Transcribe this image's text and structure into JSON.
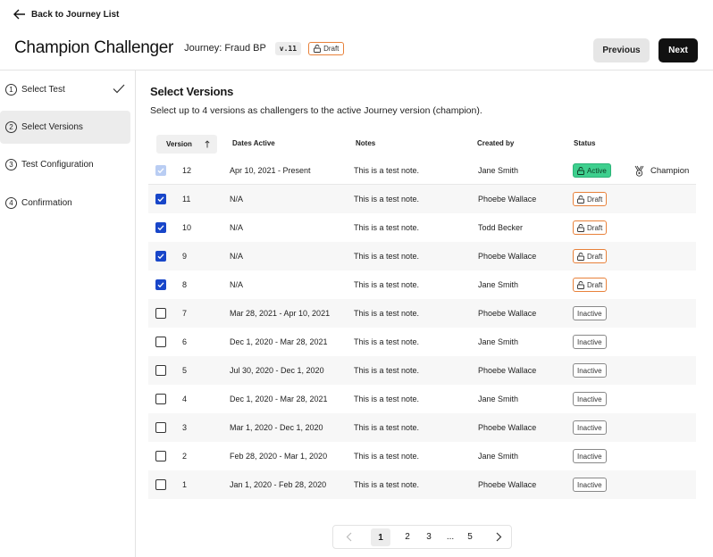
{
  "header": {
    "back_label": "Back to Journey List",
    "title": "Champion Challenger",
    "journey": "Journey: Fraud BP",
    "version": "v.11",
    "status": "Draft",
    "previous_label": "Previous",
    "next_label": "Next"
  },
  "steps": [
    {
      "num": "1",
      "label": "Select Test",
      "done": true
    },
    {
      "num": "2",
      "label": "Select Versions",
      "active": true
    },
    {
      "num": "3",
      "label": "Test Configuration"
    },
    {
      "num": "4",
      "label": "Confirmation"
    }
  ],
  "main": {
    "title": "Select Versions",
    "subtitle": "Select up to 4 versions as challengers to the active Journey version (champion).",
    "columns": {
      "version": "Version",
      "dates": "Dates Active",
      "notes": "Notes",
      "created": "Created by",
      "status": "Status"
    },
    "rows": [
      {
        "checked": "disabled",
        "version": "12",
        "dates": "Apr 10, 2021 - Present",
        "notes": "This is a test note.",
        "created": "Jane Smith",
        "status": "Active",
        "status_type": "active",
        "extra": "Champion"
      },
      {
        "checked": "checked",
        "version": "11",
        "dates": "N/A",
        "notes": "This is a test note.",
        "created": "Phoebe Wallace",
        "status": "Draft",
        "status_type": "draft"
      },
      {
        "checked": "checked",
        "version": "10",
        "dates": "N/A",
        "notes": "This is a test note.",
        "created": "Todd Becker",
        "status": "Draft",
        "status_type": "draft"
      },
      {
        "checked": "checked",
        "version": "9",
        "dates": "N/A",
        "notes": "This is a test note.",
        "created": "Phoebe Wallace",
        "status": "Draft",
        "status_type": "draft"
      },
      {
        "checked": "checked",
        "version": "8",
        "dates": "N/A",
        "notes": "This is a test note.",
        "created": "Jane Smith",
        "status": "Draft",
        "status_type": "draft"
      },
      {
        "checked": "unchecked",
        "version": "7",
        "dates": "Mar 28, 2021 - Apr 10, 2021",
        "notes": "This is a test note.",
        "created": "Phoebe Wallace",
        "status": "Inactive",
        "status_type": "inactive"
      },
      {
        "checked": "unchecked",
        "version": "6",
        "dates": "Dec 1, 2020 - Mar 28, 2021",
        "notes": "This is a test note.",
        "created": "Jane Smith",
        "status": "Inactive",
        "status_type": "inactive"
      },
      {
        "checked": "unchecked",
        "version": "5",
        "dates": "Jul 30, 2020 - Dec 1, 2020",
        "notes": "This is a test note.",
        "created": "Phoebe Wallace",
        "status": "Inactive",
        "status_type": "inactive"
      },
      {
        "checked": "unchecked",
        "version": "4",
        "dates": "Dec 1, 2020 - Mar 28, 2021",
        "notes": "This is a test note.",
        "created": "Jane Smith",
        "status": "Inactive",
        "status_type": "inactive"
      },
      {
        "checked": "unchecked",
        "version": "3",
        "dates": "Mar 1, 2020 - Dec 1, 2020",
        "notes": "This is a test note.",
        "created": "Phoebe Wallace",
        "status": "Inactive",
        "status_type": "inactive"
      },
      {
        "checked": "unchecked",
        "version": "2",
        "dates": "Feb 28, 2020 - Mar 1, 2020",
        "notes": "This is a test note.",
        "created": "Jane Smith",
        "status": "Inactive",
        "status_type": "inactive"
      },
      {
        "checked": "unchecked",
        "version": "1",
        "dates": "Jan 1, 2020 - Feb 28, 2020",
        "notes": "This is a test note.",
        "created": "Phoebe Wallace",
        "status": "Inactive",
        "status_type": "inactive"
      }
    ]
  },
  "pagination": {
    "pages": [
      "1",
      "2",
      "3",
      "...",
      "5"
    ],
    "current": "1"
  },
  "colors": {
    "accent": "#1846c9",
    "active": "#3ecf8e",
    "draft": "#e8813a"
  }
}
